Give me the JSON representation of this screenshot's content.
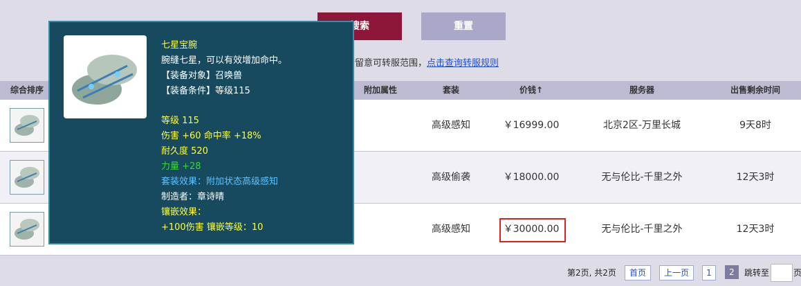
{
  "toolbar": {
    "search_label": "搜索",
    "reset_label": "重置"
  },
  "notice": {
    "text": "请留意可转服范围，",
    "link": "点击查询转服规则"
  },
  "table": {
    "headers": [
      "综合排序",
      "附加属性",
      "套装",
      "价钱↑",
      "服务器",
      "出售剩余时间"
    ],
    "rows": [
      {
        "set": "高级感知",
        "price": "￥16999.00",
        "server": "北京2区-万里长城",
        "time": "9天8时"
      },
      {
        "set": "高级偷袭",
        "price": "￥18000.00",
        "server": "无与伦比-千里之外",
        "time": "12天3时"
      },
      {
        "set": "高级感知",
        "price": "￥30000.00",
        "server": "无与伦比-千里之外",
        "time": "12天3时"
      }
    ]
  },
  "pager": {
    "info": "第2页, 共2页",
    "first": "首页",
    "prev": "上一页",
    "page1": "1",
    "page2": "2",
    "jump_label": "跳转至",
    "page_suffix": "页"
  },
  "tooltip": {
    "name": "七星宝腕",
    "desc": "腕缝七星，可以有效增加命中。",
    "target": "【装备对象】召唤兽",
    "condition": "【装备条件】等级115",
    "level": "等级 115",
    "stats": "伤害 +60 命中率 +18%",
    "durability": "耐久度 520",
    "strength": "力量 +28",
    "set_effect": "套装效果：附加状态高级感知",
    "maker": "制造者：章诗晴",
    "inlay_title": "镶嵌效果：",
    "inlay": "+100伤害 镶嵌等级：10"
  }
}
